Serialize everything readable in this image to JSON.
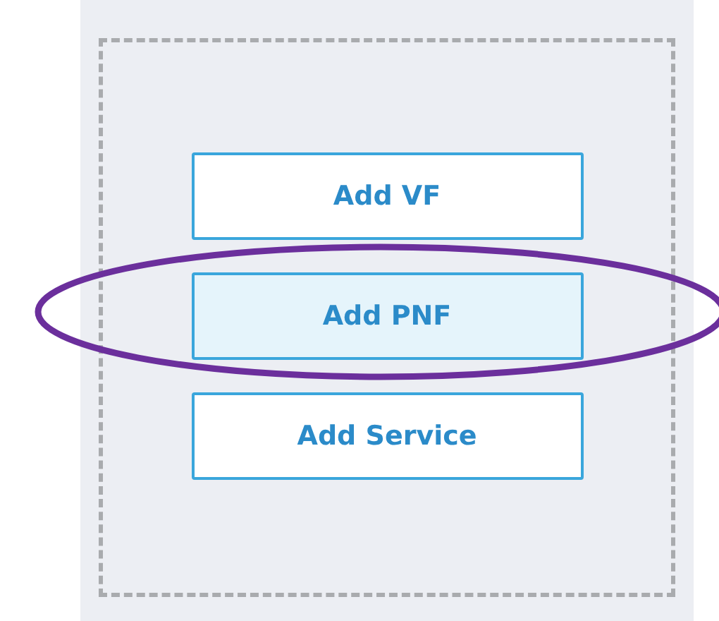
{
  "buttons": [
    {
      "label": "Add VF",
      "selected": false
    },
    {
      "label": "Add PNF",
      "selected": true
    },
    {
      "label": "Add Service",
      "selected": false
    }
  ]
}
